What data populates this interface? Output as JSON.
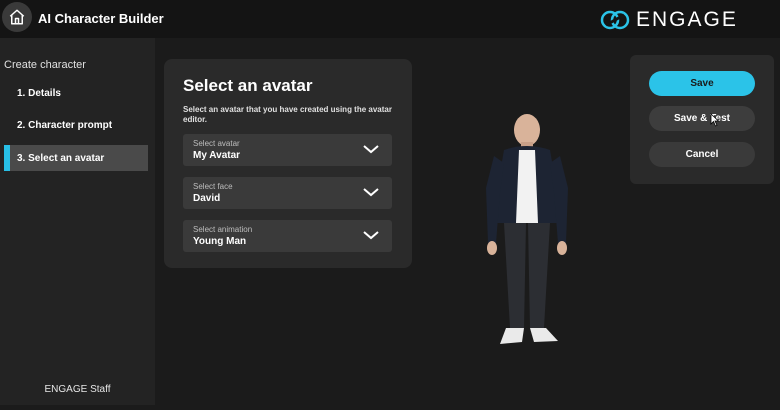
{
  "header": {
    "title": "AI Character Builder",
    "logo_text": "ENGAGE",
    "home_icon": "home-icon"
  },
  "sidebar": {
    "heading": "Create character",
    "items": [
      {
        "label": "1. Details",
        "active": false
      },
      {
        "label": "2. Character prompt",
        "active": false
      },
      {
        "label": "3. Select an avatar",
        "active": true
      }
    ],
    "footer": "ENGAGE Staff"
  },
  "panel": {
    "title": "Select an avatar",
    "description": "Select an avatar that you have created using the avatar editor.",
    "selects": [
      {
        "label": "Select avatar",
        "value": "My Avatar"
      },
      {
        "label": "Select face",
        "value": "David"
      },
      {
        "label": "Select animation",
        "value": "Young Man"
      }
    ]
  },
  "actions": {
    "save_label": "Save",
    "save_test_label": "Save & Test",
    "cancel_label": "Cancel"
  },
  "colors": {
    "accent": "#2bc3e8",
    "background": "#1b1b1b",
    "panel": "#2a2a2a"
  }
}
